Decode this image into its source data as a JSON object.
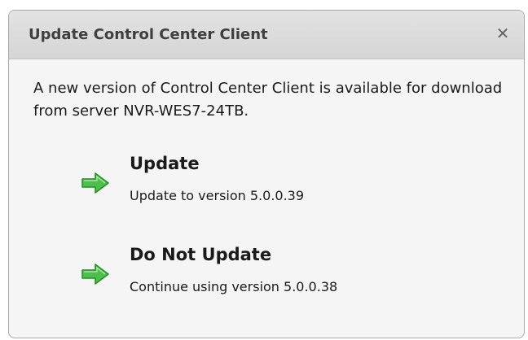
{
  "dialog": {
    "title": "Update Control Center Client",
    "close_label": "✕",
    "message": "A new version of Control Center Client is available for download from server NVR-WES7-24TB.",
    "options": [
      {
        "title": "Update",
        "subtitle": "Update to version 5.0.0.39",
        "icon": "green-arrow-icon"
      },
      {
        "title": "Do Not Update",
        "subtitle": "Continue using version 5.0.0.38",
        "icon": "green-arrow-icon"
      }
    ]
  },
  "colors": {
    "arrow_fill": "#4cc04a",
    "arrow_stroke": "#2a8a29",
    "titlebar": "#dcdcdc",
    "body": "#f5f5f5"
  }
}
